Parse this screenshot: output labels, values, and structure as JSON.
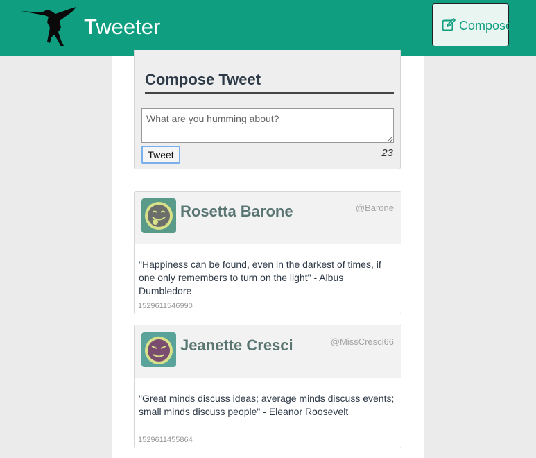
{
  "nav": {
    "brand": "Tweeter",
    "compose_label": "Compose",
    "color": "#0f9f80"
  },
  "compose": {
    "title": "Compose Tweet",
    "placeholder": "What are you humming about?",
    "button_label": "Tweet",
    "counter": "23"
  },
  "tweets": [
    {
      "name": "Rosetta Barone",
      "handle": "@Barone",
      "text": "\"Happiness can be found, even in the darkest of times, if one only remembers to turn on the light\" - Albus Dumbledore",
      "timestamp": "1529611546990",
      "avatar_icon": "tongue-out-face-icon"
    },
    {
      "name": "Jeanette Cresci",
      "handle": "@MissCresci66",
      "text": "\"Great minds discuss ideas; average minds discuss events; small minds discuss people\" - Eleanor Roosevelt",
      "timestamp": "1529611455864",
      "avatar_icon": "grumpy-face-icon"
    }
  ]
}
